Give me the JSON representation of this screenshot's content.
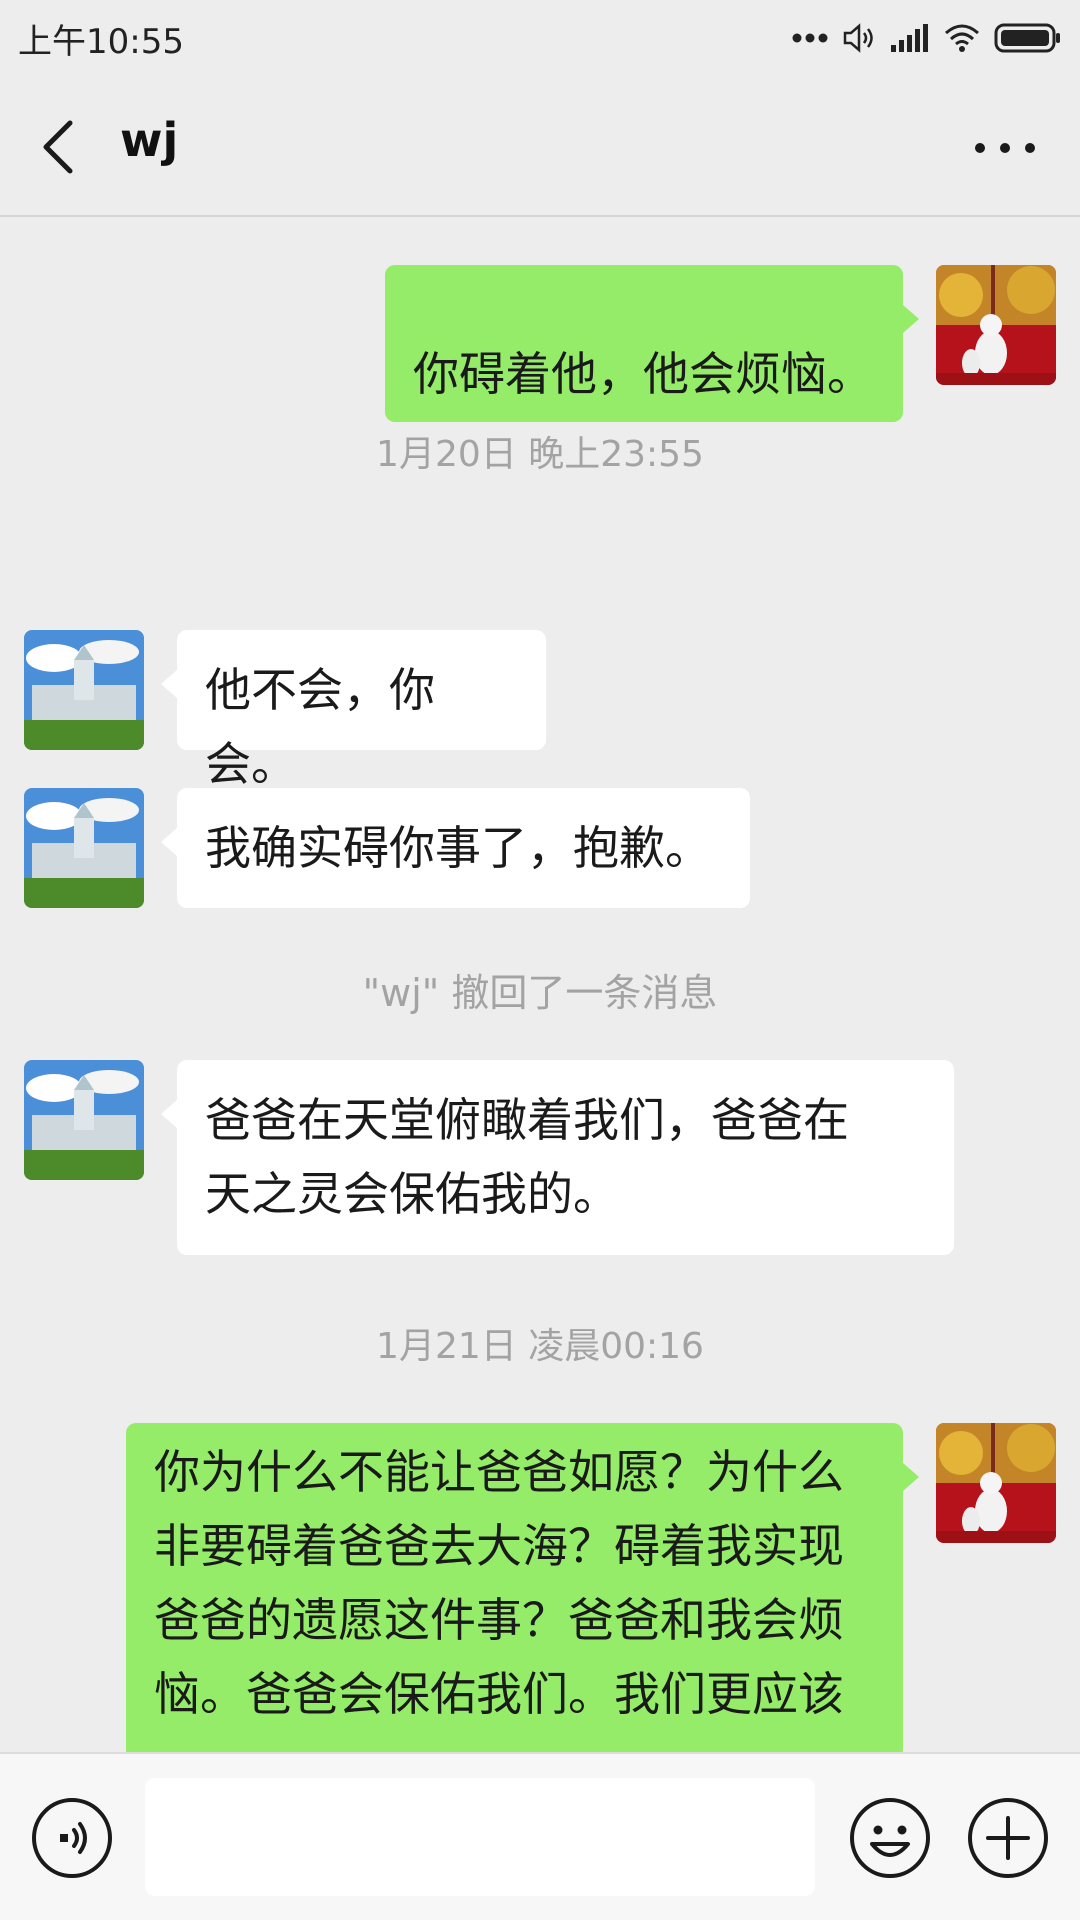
{
  "status_bar": {
    "time": "上午10:55"
  },
  "header": {
    "title": "wj"
  },
  "messages": [
    {
      "side": "out",
      "text": "你碍着他，他会烦恼。"
    },
    {
      "type": "time",
      "text": "1月20日 晚上23:55"
    },
    {
      "side": "in",
      "text": "他不会，你会。"
    },
    {
      "side": "in",
      "text": "我确实碍你事了，抱歉。"
    },
    {
      "type": "notice",
      "text": "\"wj\" 撤回了一条消息"
    },
    {
      "side": "in",
      "lines": [
        "爸爸在天堂俯瞰着我们，爸爸在",
        "天之灵会保佑我的。"
      ]
    },
    {
      "type": "time",
      "text": "1月21日 凌晨00:16"
    },
    {
      "side": "out",
      "lines": [
        "你为什么不能让爸爸如愿？为什么",
        "非要碍着爸爸去大海？碍着我实现",
        "爸爸的遗愿这件事？爸爸和我会烦",
        "恼。爸爸会保佑我们。我们更应该"
      ]
    }
  ],
  "input_bar": {
    "value": ""
  },
  "icons": {
    "back": "chevron-left-icon",
    "more": "more-dots-icon",
    "voice": "voice-icon",
    "emoji": "emoji-icon",
    "plus": "plus-icon"
  },
  "colors": {
    "outgoing_bubble": "#95ec69",
    "incoming_bubble": "#ffffff",
    "background": "#ededed"
  }
}
